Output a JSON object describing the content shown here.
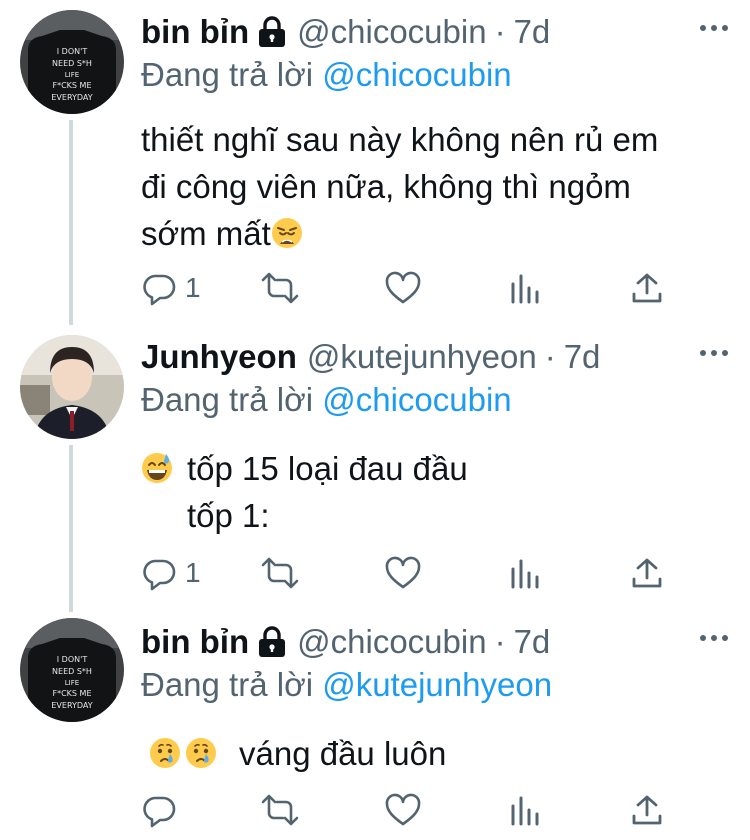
{
  "tweets": [
    {
      "name": "bin bỉn",
      "protected": true,
      "handle": "@chicocubin",
      "separator": "·",
      "time": "7d",
      "reply_prefix": "Đang trả lời",
      "reply_to": "@chicocubin",
      "text_lines": [
        "thiết nghĩ sau này không nên rủ em",
        "đi công viên nữa, không thì ngỏm",
        "sớm mất"
      ],
      "emoji": "weary-face",
      "avatar": "avatar-shirt-text",
      "reply_count": "1"
    },
    {
      "name": "Junhyeon",
      "protected": false,
      "handle": "@kutejunhyeon",
      "separator": "·",
      "time": "7d",
      "reply_prefix": "Đang trả lời",
      "reply_to": "@chicocubin",
      "text_lines": [
        "tốp 15 loại đau đầu",
        "tốp 1:"
      ],
      "emoji": "grinning-sweat-face",
      "avatar": "avatar-school-uniform",
      "reply_count": "1"
    },
    {
      "name": "bin bỉn",
      "protected": true,
      "handle": "@chicocubin",
      "separator": "·",
      "time": "7d",
      "reply_prefix": "Đang trả lời",
      "reply_to": "@kutejunhyeon",
      "text_lines": [
        "váng đầu luôn"
      ],
      "emoji": "crying-face",
      "avatar": "avatar-shirt-text",
      "reply_count": ""
    }
  ],
  "avatar_shirt_text": [
    "I DON'T",
    "NEED S*H",
    "LIFE",
    "F*CKS ME",
    "EVERYDAY"
  ],
  "icons": [
    "lock-icon",
    "more-icon",
    "reply-icon",
    "retweet-icon",
    "like-icon",
    "stats-icon",
    "share-icon"
  ],
  "colors": {
    "text": "#0f1419",
    "secondary": "#536471",
    "link": "#1d9bf0",
    "thread_line": "#cfd9de"
  }
}
